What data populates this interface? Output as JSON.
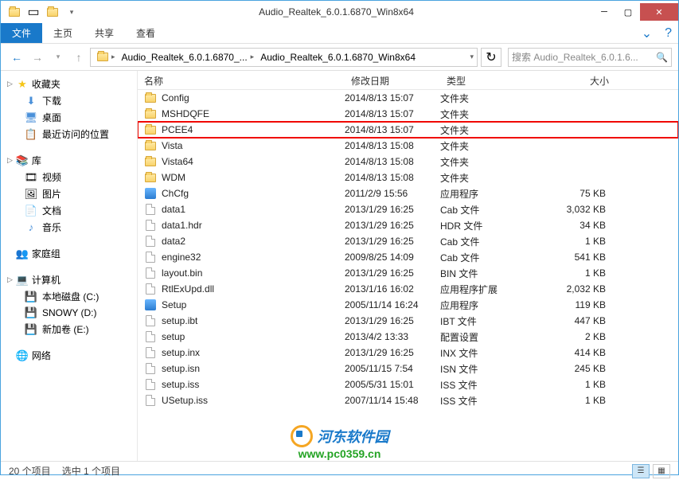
{
  "window": {
    "title": "Audio_Realtek_6.0.1.6870_Win8x64"
  },
  "ribbon": {
    "file": "文件",
    "home": "主页",
    "share": "共享",
    "view": "查看"
  },
  "breadcrumb": {
    "seg1": "Audio_Realtek_6.0.1.6870_...",
    "seg2": "Audio_Realtek_6.0.1.6870_Win8x64"
  },
  "search": {
    "placeholder": "搜索 Audio_Realtek_6.0.1.6..."
  },
  "sidebar": {
    "fav": {
      "label": "收藏夹",
      "items": [
        "下载",
        "桌面",
        "最近访问的位置"
      ]
    },
    "lib": {
      "label": "库",
      "items": [
        "视频",
        "图片",
        "文档",
        "音乐"
      ]
    },
    "home": {
      "label": "家庭组"
    },
    "pc": {
      "label": "计算机",
      "items": [
        "本地磁盘 (C:)",
        "SNOWY (D:)",
        "新加卷 (E:)"
      ]
    },
    "net": {
      "label": "网络"
    }
  },
  "columns": {
    "name": "名称",
    "date": "修改日期",
    "type": "类型",
    "size": "大小"
  },
  "files": [
    {
      "icon": "folder",
      "name": "Config",
      "date": "2014/8/13 15:07",
      "type": "文件夹",
      "size": ""
    },
    {
      "icon": "folder",
      "name": "MSHDQFE",
      "date": "2014/8/13 15:07",
      "type": "文件夹",
      "size": ""
    },
    {
      "icon": "folder",
      "name": "PCEE4",
      "date": "2014/8/13 15:07",
      "type": "文件夹",
      "size": "",
      "hl": true
    },
    {
      "icon": "folder",
      "name": "Vista",
      "date": "2014/8/13 15:08",
      "type": "文件夹",
      "size": ""
    },
    {
      "icon": "folder",
      "name": "Vista64",
      "date": "2014/8/13 15:08",
      "type": "文件夹",
      "size": ""
    },
    {
      "icon": "folder",
      "name": "WDM",
      "date": "2014/8/13 15:08",
      "type": "文件夹",
      "size": ""
    },
    {
      "icon": "exe",
      "name": "ChCfg",
      "date": "2011/2/9 15:56",
      "type": "应用程序",
      "size": "75 KB"
    },
    {
      "icon": "file",
      "name": "data1",
      "date": "2013/1/29 16:25",
      "type": "Cab 文件",
      "size": "3,032 KB"
    },
    {
      "icon": "file",
      "name": "data1.hdr",
      "date": "2013/1/29 16:25",
      "type": "HDR 文件",
      "size": "34 KB"
    },
    {
      "icon": "file",
      "name": "data2",
      "date": "2013/1/29 16:25",
      "type": "Cab 文件",
      "size": "1 KB"
    },
    {
      "icon": "file",
      "name": "engine32",
      "date": "2009/8/25 14:09",
      "type": "Cab 文件",
      "size": "541 KB"
    },
    {
      "icon": "file",
      "name": "layout.bin",
      "date": "2013/1/29 16:25",
      "type": "BIN 文件",
      "size": "1 KB"
    },
    {
      "icon": "file",
      "name": "RtlExUpd.dll",
      "date": "2013/1/16 16:02",
      "type": "应用程序扩展",
      "size": "2,032 KB"
    },
    {
      "icon": "exe",
      "name": "Setup",
      "date": "2005/11/14 16:24",
      "type": "应用程序",
      "size": "119 KB"
    },
    {
      "icon": "file",
      "name": "setup.ibt",
      "date": "2013/1/29 16:25",
      "type": "IBT 文件",
      "size": "447 KB"
    },
    {
      "icon": "file",
      "name": "setup",
      "date": "2013/4/2 13:33",
      "type": "配置设置",
      "size": "2 KB"
    },
    {
      "icon": "file",
      "name": "setup.inx",
      "date": "2013/1/29 16:25",
      "type": "INX 文件",
      "size": "414 KB"
    },
    {
      "icon": "file",
      "name": "setup.isn",
      "date": "2005/11/15 7:54",
      "type": "ISN 文件",
      "size": "245 KB"
    },
    {
      "icon": "file",
      "name": "setup.iss",
      "date": "2005/5/31 15:01",
      "type": "ISS 文件",
      "size": "1 KB"
    },
    {
      "icon": "file",
      "name": "USetup.iss",
      "date": "2007/11/14 15:48",
      "type": "ISS 文件",
      "size": "1 KB"
    }
  ],
  "status": {
    "count": "20 个项目",
    "selected": "选中 1 个项目"
  },
  "watermark": {
    "text": "河东软件园",
    "url": "www.pc0359.cn"
  }
}
